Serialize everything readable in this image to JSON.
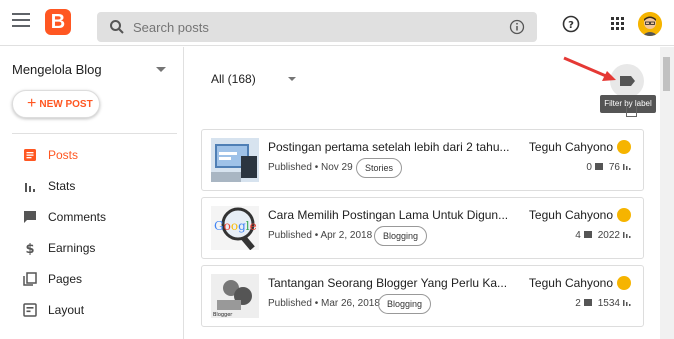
{
  "header": {
    "search_placeholder": "Search posts"
  },
  "sidebar": {
    "blog_name": "Mengelola Blog",
    "new_post_label": "NEW POST",
    "items": [
      {
        "label": "Posts",
        "icon": "posts-icon",
        "active": true
      },
      {
        "label": "Stats",
        "icon": "stats-icon"
      },
      {
        "label": "Comments",
        "icon": "comments-icon"
      },
      {
        "label": "Earnings",
        "icon": "earnings-icon"
      },
      {
        "label": "Pages",
        "icon": "pages-icon"
      },
      {
        "label": "Layout",
        "icon": "layout-icon"
      }
    ]
  },
  "main": {
    "filter_label": "All (168)",
    "tooltip": "Filter by label",
    "posts": [
      {
        "title": "Postingan pertama setelah lebih dari 2 tahu...",
        "status": "Published",
        "date": "Nov 29",
        "label": "Stories",
        "author": "Teguh Cahyono",
        "comments": "0",
        "views": "76"
      },
      {
        "title": "Cara Memilih Postingan Lama Untuk Digun...",
        "status": "Published",
        "date": "Apr 2, 2018",
        "label": "Blogging",
        "author": "Teguh Cahyono",
        "comments": "4",
        "views": "2022"
      },
      {
        "title": "Tantangan Seorang Blogger Yang Perlu Ka...",
        "status": "Published",
        "date": "Mar 26, 2018",
        "label": "Blogging",
        "author": "Teguh Cahyono",
        "comments": "2",
        "views": "1534"
      }
    ]
  },
  "colors": {
    "accent": "#ff5722",
    "arrow": "#e53935"
  }
}
